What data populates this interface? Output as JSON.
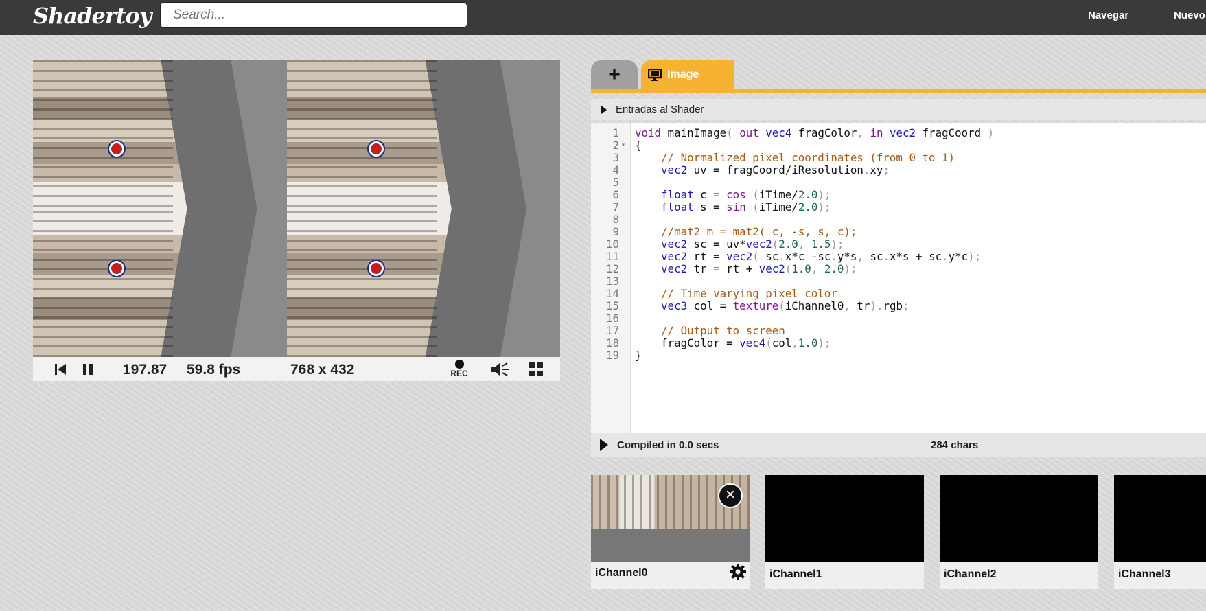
{
  "header": {
    "logo": "Shadertoy",
    "search_placeholder": "Search...",
    "nav_browse": "Navegar",
    "nav_new": "Nuevo"
  },
  "player": {
    "time": "197.87",
    "fps": "59.8 fps",
    "resolution": "768 x 432",
    "rec_label": "REC"
  },
  "editor": {
    "tab_image": "Image",
    "shader_inputs": "Entradas al Shader",
    "compiled": "Compiled in 0.0 secs",
    "chars": "284 chars",
    "lines": [
      "void mainImage( out vec4 fragColor, in vec2 fragCoord )",
      "{",
      "    // Normalized pixel coordinates (from 0 to 1)",
      "    vec2 uv = fragCoord/iResolution.xy;",
      "",
      "    float c = cos (iTime/2.0);",
      "    float s = sin (iTime/2.0);",
      "",
      "    //mat2 m = mat2( c, -s, s, c);",
      "    vec2 sc = uv*vec2(2.0, 1.5);",
      "    vec2 rt = vec2( sc.x*c -sc.y*s, sc.x*s + sc.y*c);",
      "    vec2 tr = rt + vec2(1.0, 2.0);",
      "",
      "    // Time varying pixel color",
      "    vec3 col = texture(iChannel0, tr).rgb;",
      "",
      "    // Output to screen",
      "    fragColor = vec4(col,1.0);",
      "}"
    ]
  },
  "channels": [
    {
      "label": "iChannel0"
    },
    {
      "label": "iChannel1"
    },
    {
      "label": "iChannel2"
    },
    {
      "label": "iChannel3"
    }
  ],
  "colors": {
    "accent": "#f6b332",
    "topbar": "#3a3a3a"
  }
}
